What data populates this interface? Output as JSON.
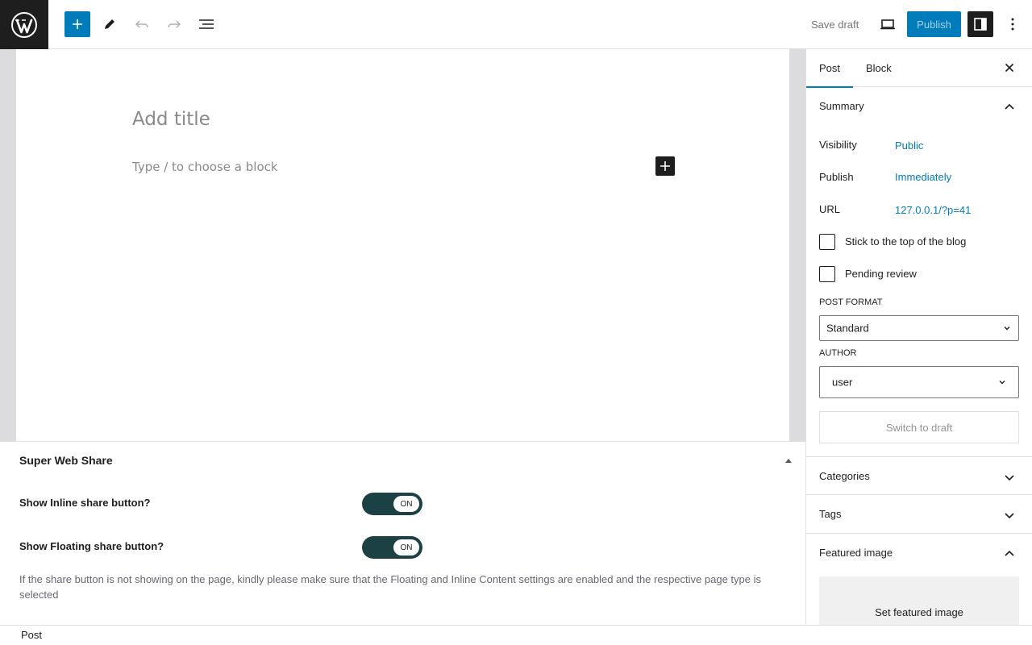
{
  "topbar": {
    "logo_icon": "wordpress-logo-icon",
    "add_block_icon": "plus-icon",
    "tools_icon": "pencil-icon",
    "undo_icon": "undo-icon",
    "redo_icon": "redo-icon",
    "list_view_icon": "list-view-icon",
    "save_draft_label": "Save draft",
    "preview_icon": "desktop-icon",
    "publish_label": "Publish",
    "settings_icon": "sidebar-toggle-icon",
    "more_icon": "more-vertical-icon"
  },
  "editor": {
    "title_placeholder": "Add title",
    "block_placeholder": "Type / to choose a block"
  },
  "metabox": {
    "title": "Super Web Share",
    "options": [
      {
        "label": "Show Inline share button?",
        "state": "ON"
      },
      {
        "label": "Show Floating share button?",
        "state": "ON"
      }
    ],
    "note": "If the share button is not showing on the page, kindly please make sure that the Floating and Inline Content settings are enabled and the respective page type is selected"
  },
  "footer": {
    "breadcrumb": "Post"
  },
  "sidebar": {
    "tabs": [
      "Post",
      "Block"
    ],
    "summary": {
      "title": "Summary",
      "visibility_label": "Visibility",
      "visibility_value": "Public",
      "publish_label": "Publish",
      "publish_value": "Immediately",
      "url_label": "URL",
      "url_value": "127.0.0.1/?p=41",
      "sticky_label": "Stick to the top of the blog",
      "pending_label": "Pending review",
      "post_format_caption": "POST FORMAT",
      "post_format_value": "Standard",
      "author_caption": "AUTHOR",
      "author_value": "user",
      "switch_to_draft_label": "Switch to draft"
    },
    "panels": {
      "categories": "Categories",
      "tags": "Tags",
      "featured_image": "Featured image",
      "set_featured_image": "Set featured image"
    }
  },
  "colors": {
    "accent": "#007cba",
    "toggle_on": "#1b4145",
    "dark": "#1e1e1e"
  }
}
